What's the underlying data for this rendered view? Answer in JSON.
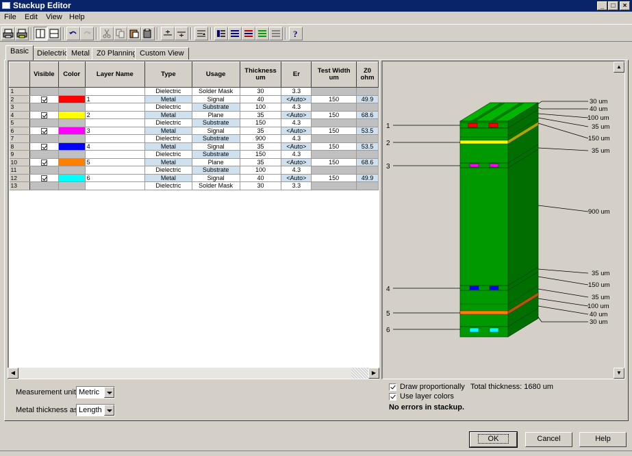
{
  "window": {
    "title": "Stackup Editor",
    "controls": [
      "_",
      "□",
      "×"
    ]
  },
  "menu": [
    {
      "label": "File",
      "name": "file"
    },
    {
      "label": "Edit",
      "name": "edit"
    },
    {
      "label": "View",
      "name": "view"
    },
    {
      "label": "Help",
      "name": "help"
    }
  ],
  "toolbar_icons": [
    "print-icon",
    "print-setup-icon",
    "columns-view-icon",
    "rows-view-icon",
    "undo-icon",
    "redo-icon",
    "cut-icon",
    "copy-icon",
    "paste-icon",
    "paste-special-icon",
    "insert-above-icon",
    "insert-below-icon",
    "renumber-icon",
    "layer-list-icon",
    "list-view-icon",
    "red-layers-icon",
    "green-layers-icon",
    "gray-layers-icon",
    "help-icon"
  ],
  "tabs": [
    {
      "label": "Basic",
      "name": "basic"
    },
    {
      "label": "Dielectric",
      "name": "dielectric"
    },
    {
      "label": "Metal",
      "name": "metal"
    },
    {
      "label": "Z0 Planning",
      "name": "z0-planning"
    },
    {
      "label": "Custom View",
      "name": "custom-view"
    }
  ],
  "grid": {
    "columns": [
      {
        "key": "visible",
        "label": "Visible",
        "unit": ""
      },
      {
        "key": "color",
        "label": "Color",
        "unit": ""
      },
      {
        "key": "layer_name",
        "label": "Layer Name",
        "unit": ""
      },
      {
        "key": "type",
        "label": "Type",
        "unit": ""
      },
      {
        "key": "usage",
        "label": "Usage",
        "unit": ""
      },
      {
        "key": "thickness",
        "label": "Thickness",
        "unit": "um"
      },
      {
        "key": "er",
        "label": "Er",
        "unit": ""
      },
      {
        "key": "test_width",
        "label": "Test Width",
        "unit": "um"
      },
      {
        "key": "z0",
        "label": "Z0",
        "unit": "ohm"
      }
    ],
    "rows": [
      {
        "num": "1",
        "visible": false,
        "color": "",
        "layer_name": "",
        "type": "Dielectric",
        "usage": "Solder Mask",
        "thickness": "30",
        "er": "3.3",
        "test_width": "",
        "z0": ""
      },
      {
        "num": "2",
        "visible": true,
        "color": "#ff0000",
        "layer_name": "1",
        "type": "Metal",
        "usage": "Signal",
        "thickness": "40",
        "er": "<Auto>",
        "test_width": "150",
        "z0": "49.9"
      },
      {
        "num": "3",
        "visible": false,
        "color": "",
        "layer_name": "",
        "type": "Dielectric",
        "usage": "Substrate",
        "thickness": "100",
        "er": "4.3",
        "test_width": "",
        "z0": ""
      },
      {
        "num": "4",
        "visible": true,
        "color": "#ffff00",
        "layer_name": "2",
        "type": "Metal",
        "usage": "Plane",
        "thickness": "35",
        "er": "<Auto>",
        "test_width": "150",
        "z0": "68.6"
      },
      {
        "num": "5",
        "visible": false,
        "color": "",
        "layer_name": "",
        "type": "Dielectric",
        "usage": "Substrate",
        "thickness": "150",
        "er": "4.3",
        "test_width": "",
        "z0": ""
      },
      {
        "num": "6",
        "visible": true,
        "color": "#ff00ff",
        "layer_name": "3",
        "type": "Metal",
        "usage": "Signal",
        "thickness": "35",
        "er": "<Auto>",
        "test_width": "150",
        "z0": "53.5"
      },
      {
        "num": "7",
        "visible": false,
        "color": "",
        "layer_name": "",
        "type": "Dielectric",
        "usage": "Substrate",
        "thickness": "900",
        "er": "4.3",
        "test_width": "",
        "z0": ""
      },
      {
        "num": "8",
        "visible": true,
        "color": "#0000ff",
        "layer_name": "4",
        "type": "Metal",
        "usage": "Signal",
        "thickness": "35",
        "er": "<Auto>",
        "test_width": "150",
        "z0": "53.5"
      },
      {
        "num": "9",
        "visible": false,
        "color": "",
        "layer_name": "",
        "type": "Dielectric",
        "usage": "Substrate",
        "thickness": "150",
        "er": "4.3",
        "test_width": "",
        "z0": ""
      },
      {
        "num": "10",
        "visible": true,
        "color": "#ff8000",
        "layer_name": "5",
        "type": "Metal",
        "usage": "Plane",
        "thickness": "35",
        "er": "<Auto>",
        "test_width": "150",
        "z0": "68.6"
      },
      {
        "num": "11",
        "visible": false,
        "color": "",
        "layer_name": "",
        "type": "Dielectric",
        "usage": "Substrate",
        "thickness": "100",
        "er": "4.3",
        "test_width": "",
        "z0": ""
      },
      {
        "num": "12",
        "visible": true,
        "color": "#00ffff",
        "layer_name": "6",
        "type": "Metal",
        "usage": "Signal",
        "thickness": "40",
        "er": "<Auto>",
        "test_width": "150",
        "z0": "49.9"
      },
      {
        "num": "13",
        "visible": false,
        "color": "",
        "layer_name": "",
        "type": "Dielectric",
        "usage": "Solder Mask",
        "thickness": "30",
        "er": "3.3",
        "test_width": "",
        "z0": ""
      }
    ]
  },
  "settings": {
    "measurement_units_label": "Measurement units:",
    "measurement_units_value": "Metric",
    "metal_thickness_label": "Metal thickness as:",
    "metal_thickness_value": "Length"
  },
  "diagram": {
    "layer_labels": [
      "1",
      "2",
      "3",
      "4",
      "5",
      "6"
    ],
    "thickness_labels": [
      "30 um",
      "40 um",
      "100 um",
      "35 um",
      "150 um",
      "35 um",
      "900 um",
      "35 um",
      "150 um",
      "35 um",
      "100 um",
      "40 um",
      "30 um"
    ],
    "board_color": "#009a00",
    "board_side_color": "#006e00",
    "board_top_color": "#00b400"
  },
  "options": {
    "draw_proportionally": "Draw proportionally",
    "use_layer_colors": "Use layer colors",
    "total_thickness": "Total thickness:  1680 um",
    "status": "No errors in stackup."
  },
  "buttons": {
    "ok": "OK",
    "cancel": "Cancel",
    "help": "Help"
  }
}
